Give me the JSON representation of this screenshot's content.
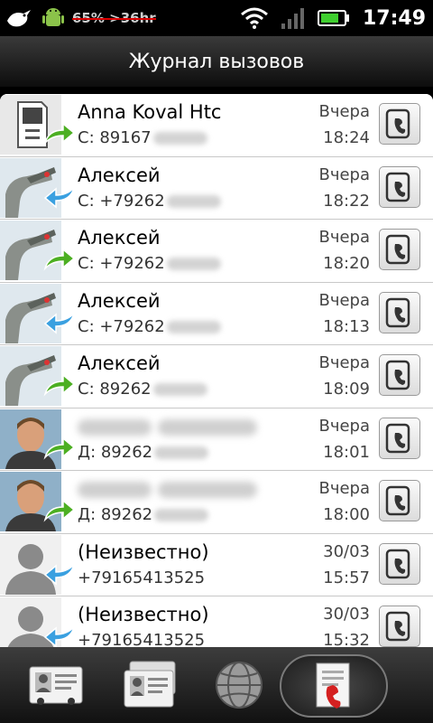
{
  "status_bar": {
    "battery_text": "65% >36hr",
    "time": "17:49",
    "icons": [
      "bird-icon",
      "android-icon",
      "wifi-icon",
      "signal-icon",
      "battery-icon"
    ]
  },
  "header": {
    "title": "Журнал вызовов"
  },
  "calls": [
    {
      "name": "Anna Koval Htc",
      "number": "С: 89167",
      "date": "Вчера",
      "time": "18:24",
      "direction": "outgoing",
      "avatar": "sim"
    },
    {
      "name": "Алексей",
      "number": "С: +79262",
      "date": "Вчера",
      "time": "18:22",
      "direction": "incoming",
      "avatar": "robot"
    },
    {
      "name": "Алексей",
      "number": "С: +79262",
      "date": "Вчера",
      "time": "18:20",
      "direction": "outgoing",
      "avatar": "robot"
    },
    {
      "name": "Алексей",
      "number": "С: +79262",
      "date": "Вчера",
      "time": "18:13",
      "direction": "incoming",
      "avatar": "robot"
    },
    {
      "name": "Алексей",
      "number": "С: 89262",
      "date": "Вчера",
      "time": "18:09",
      "direction": "outgoing",
      "avatar": "robot"
    },
    {
      "name": "",
      "number": "Д: 89262",
      "date": "Вчера",
      "time": "18:01",
      "direction": "outgoing",
      "avatar": "man"
    },
    {
      "name": "",
      "number": "Д: 89262",
      "date": "Вчера",
      "time": "18:00",
      "direction": "outgoing",
      "avatar": "man"
    },
    {
      "name": "(Неизвестно)",
      "number": "+79165413525",
      "date": "30/03",
      "time": "15:57",
      "direction": "incoming",
      "avatar": "unknown"
    },
    {
      "name": "(Неизвестно)",
      "number": "+79165413525",
      "date": "30/03",
      "time": "15:32",
      "direction": "incoming",
      "avatar": "unknown"
    }
  ],
  "bottom_tabs": [
    "contacts-tab",
    "groups-tab",
    "online-tab",
    "call-log-tab"
  ],
  "colors": {
    "accent_green": "#4caf22",
    "accent_blue": "#3aa0e0",
    "call_red": "#d42020"
  }
}
